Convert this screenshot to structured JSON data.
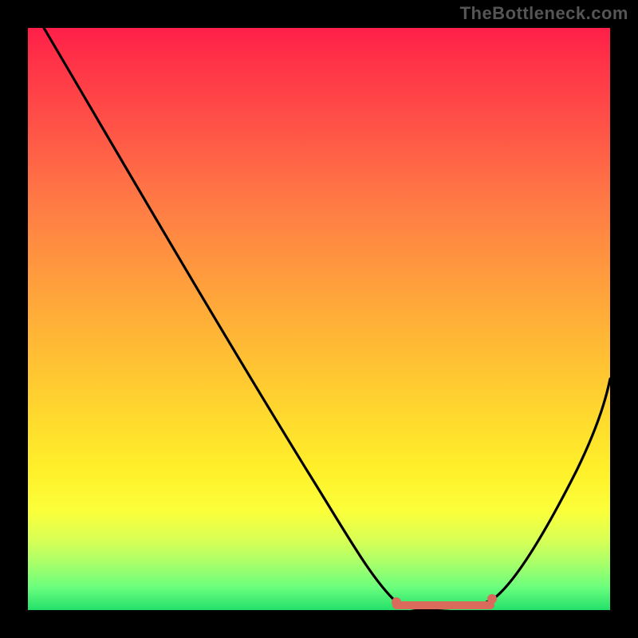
{
  "watermark": "TheBottleneck.com",
  "chart_data": {
    "type": "line",
    "title": "",
    "xlabel": "",
    "ylabel": "",
    "x_range": [
      0,
      100
    ],
    "y_range": [
      0,
      100
    ],
    "x": [
      0,
      5,
      10,
      15,
      20,
      25,
      30,
      35,
      40,
      45,
      50,
      55,
      60,
      63,
      66,
      70,
      74,
      78,
      80,
      84,
      88,
      92,
      96,
      100
    ],
    "values": [
      100,
      93,
      85,
      77.5,
      70,
      62.5,
      55,
      47.5,
      40,
      32.5,
      25,
      18,
      11,
      6,
      2.5,
      0.5,
      0,
      0.5,
      2,
      6,
      12,
      20,
      30,
      42
    ],
    "optimum_band": {
      "x_start": 63,
      "x_end": 80,
      "y": 0
    },
    "gradient_stops": [
      {
        "pos": 0.0,
        "color": "#ff1f49"
      },
      {
        "pos": 0.3,
        "color": "#ff7a45"
      },
      {
        "pos": 0.66,
        "color": "#ffd72e"
      },
      {
        "pos": 0.83,
        "color": "#fbff3a"
      },
      {
        "pos": 1.0,
        "color": "#23e06a"
      }
    ]
  }
}
